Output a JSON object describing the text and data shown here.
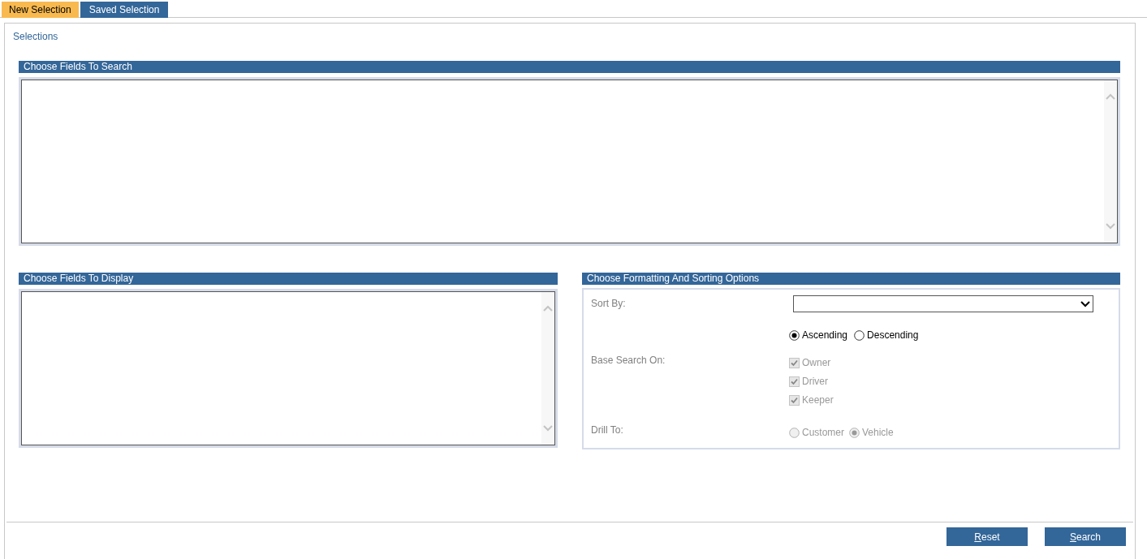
{
  "tabs": [
    {
      "label": "New Selection",
      "selected": true
    },
    {
      "label": "Saved Selection",
      "selected": false
    }
  ],
  "panel_title": "Selections",
  "search_fields": {
    "header": "Choose Fields To Search"
  },
  "display_fields": {
    "header": "Choose Fields To Display"
  },
  "options": {
    "header": "Choose Formatting And Sorting Options",
    "sort_by": {
      "label": "Sort By:"
    },
    "sort_order": [
      {
        "label": "Ascending",
        "selected": true
      },
      {
        "label": "Descending",
        "selected": false
      }
    ],
    "base_search_on": {
      "label": "Base Search On:",
      "items": [
        {
          "label": "Owner",
          "checked": true,
          "disabled": true
        },
        {
          "label": "Driver",
          "checked": true,
          "disabled": true
        },
        {
          "label": "Keeper",
          "checked": true,
          "disabled": true
        }
      ]
    },
    "drill_to": {
      "label": "Drill To:",
      "options": [
        {
          "label": "Customer",
          "selected": false,
          "disabled": true
        },
        {
          "label": "Vehicle",
          "selected": true,
          "disabled": true
        }
      ]
    }
  },
  "buttons": [
    "Reset",
    "Search"
  ]
}
